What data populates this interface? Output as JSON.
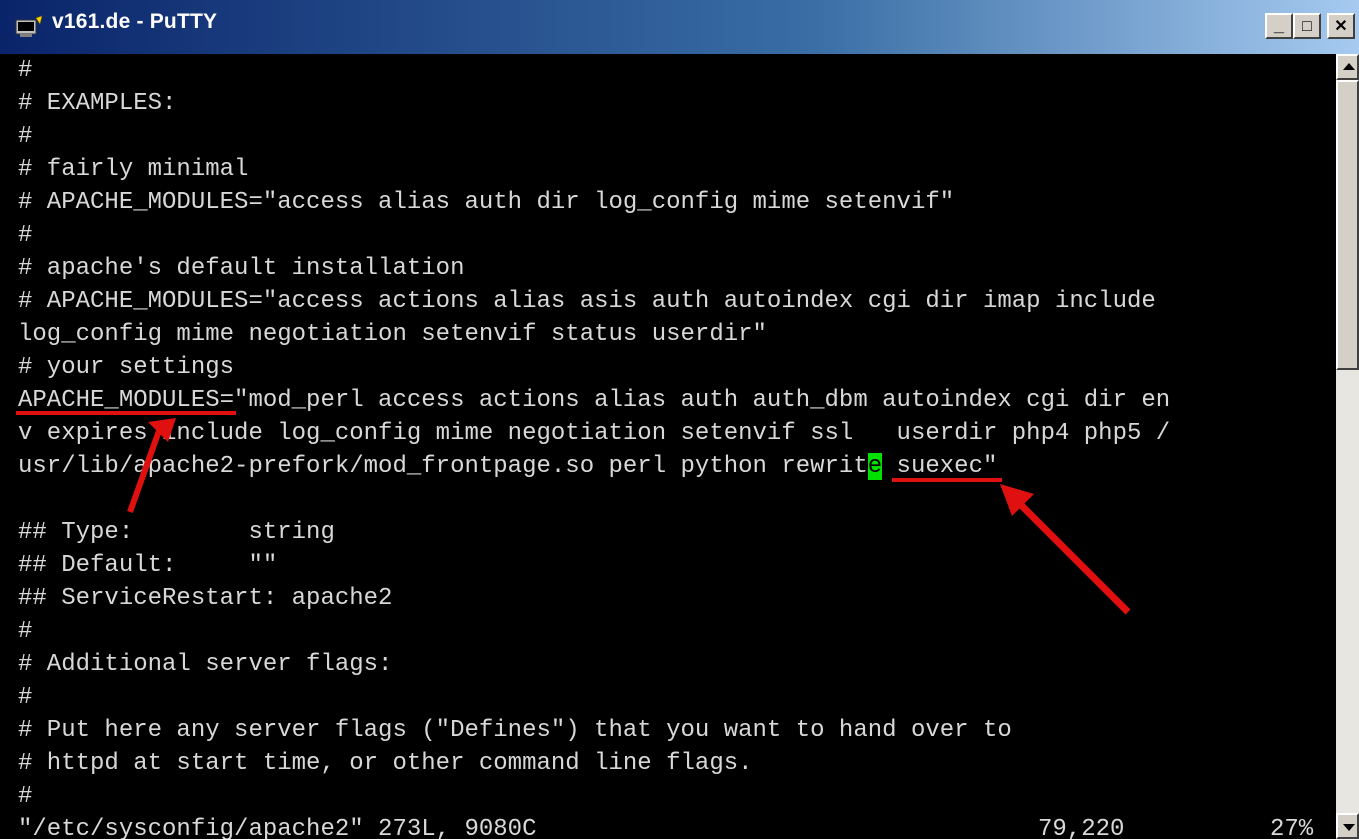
{
  "window": {
    "title": "v161.de - PuTTY",
    "minimize_label": "_",
    "maximize_label": "□",
    "close_label": "✕",
    "icon": "putty-terminal-icon"
  },
  "terminal": {
    "lines": [
      "#",
      "# EXAMPLES:",
      "#",
      "# fairly minimal",
      "# APACHE_MODULES=\"access alias auth dir log_config mime setenvif\"",
      "#",
      "# apache's default installation",
      "# APACHE_MODULES=\"access actions alias asis auth autoindex cgi dir imap include",
      "log_config mime negotiation setenvif status userdir\"",
      "# your settings",
      "APACHE_MODULES=\"mod_perl access actions alias auth auth_dbm autoindex cgi dir en",
      "v expires include log_config mime negotiation setenvif ssl   userdir php4 php5 /",
      "usr/lib/apache2-prefork/mod_frontpage.so perl python rewrite suexec\"",
      "",
      "## Type:        string",
      "## Default:     \"\"",
      "## ServiceRestart: apache2",
      "#",
      "# Additional server flags:",
      "#",
      "# Put here any server flags (\"Defines\") that you want to hand over to",
      "# httpd at start time, or other command line flags.",
      "#"
    ],
    "cursor_line_prefix": "usr/lib/apache2-prefork/mod_frontpage.so perl python rewrit",
    "cursor_char": "e",
    "cursor_line_suffix": " suexec\"",
    "cursor_color": "#00e000"
  },
  "statusline": {
    "file": "\"/etc/sysconfig/apache2\" 273L, 9080C",
    "position": "79,220",
    "percent": "27%"
  },
  "annotations": {
    "underline_color": "#e01010",
    "arrow_color": "#e01010"
  }
}
